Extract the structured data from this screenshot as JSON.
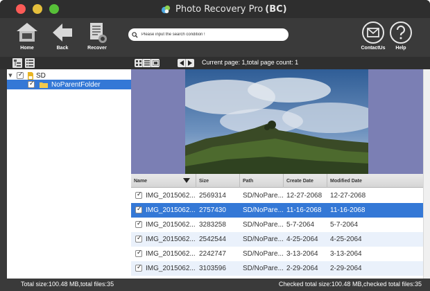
{
  "window": {
    "title": "Photo Recovery Pro",
    "title_suffix": "(BC)"
  },
  "toolbar": {
    "home_label": "Home",
    "back_label": "Back",
    "recover_label": "Recover",
    "contact_label": "ContactUs",
    "help_label": "Help",
    "search_placeholder": "Please input the search condition !"
  },
  "tree": {
    "root_label": "SD",
    "child_label": "NoParentFolder"
  },
  "pager": {
    "text": "Current page: 1,total page count: 1"
  },
  "table": {
    "columns": [
      "Name",
      "Size",
      "Path",
      "Create Date",
      "Modified Date"
    ],
    "rows": [
      {
        "name": "IMG_2015062...",
        "size": "2569314",
        "path": "SD/NoPare...",
        "create": "12-27-2068",
        "modified": "12-27-2068"
      },
      {
        "name": "IMG_2015062...",
        "size": "2757430",
        "path": "SD/NoPare...",
        "create": "11-16-2068",
        "modified": "11-16-2068"
      },
      {
        "name": "IMG_2015062...",
        "size": "3283258",
        "path": "SD/NoPare...",
        "create": "5-7-2064",
        "modified": "5-7-2064"
      },
      {
        "name": "IMG_2015062...",
        "size": "2542544",
        "path": "SD/NoPare...",
        "create": "4-25-2064",
        "modified": "4-25-2064"
      },
      {
        "name": "IMG_2015062...",
        "size": "2242747",
        "path": "SD/NoPare...",
        "create": "3-13-2064",
        "modified": "3-13-2064"
      },
      {
        "name": "IMG_2015062...",
        "size": "3103596",
        "path": "SD/NoPare...",
        "create": "2-29-2064",
        "modified": "2-29-2064"
      }
    ],
    "selected_row": 1
  },
  "status": {
    "left": "Total size:100.48 MB,total files:35",
    "right": "Checked total size:100.48 MB,checked total files:35"
  },
  "colors": {
    "selection": "#3478d6",
    "preview_bg": "#7b7fb4",
    "toolbar_bg": "#3a3a3a"
  },
  "icons": {
    "home": "house-icon",
    "back": "left-arrow-icon",
    "recover": "document-recover-icon",
    "contact": "envelope-icon",
    "help": "question-mark-icon",
    "search": "magnifier-icon"
  }
}
